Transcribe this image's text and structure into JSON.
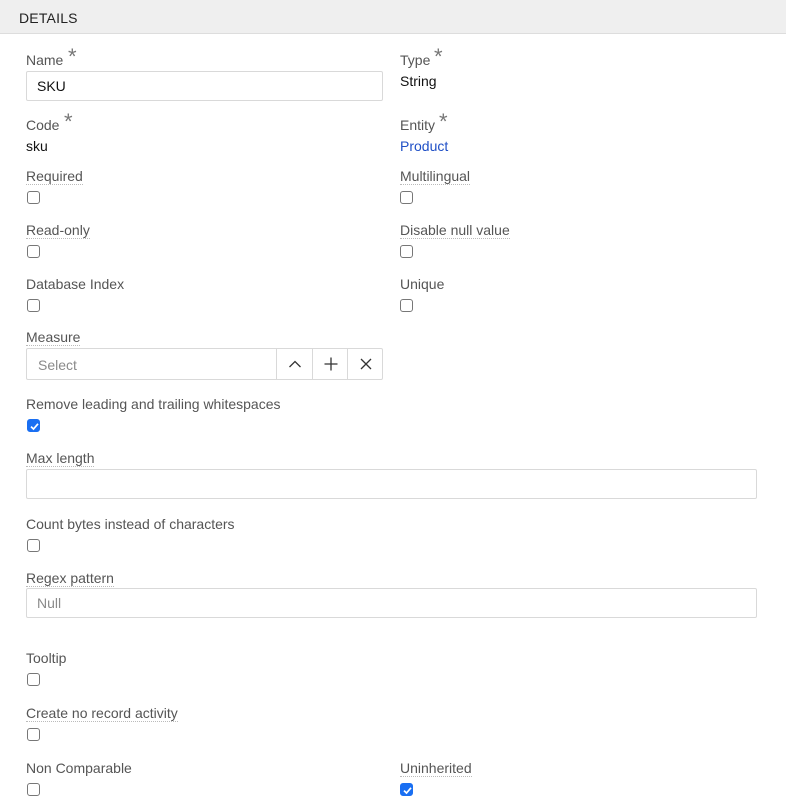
{
  "header": {
    "title": "DETAILS"
  },
  "name": {
    "label": "Name",
    "value": "SKU"
  },
  "type": {
    "label": "Type",
    "value": "String"
  },
  "code": {
    "label": "Code",
    "value": "sku"
  },
  "entity": {
    "label": "Entity",
    "value": "Product"
  },
  "required_mark": "*",
  "checkboxes": {
    "required": {
      "label": "Required",
      "checked": false
    },
    "multilingual": {
      "label": "Multilingual",
      "checked": false
    },
    "read_only": {
      "label": "Read-only",
      "checked": false
    },
    "disable_null_value": {
      "label": "Disable null value",
      "checked": false
    },
    "database_index": {
      "label": "Database Index",
      "checked": false
    },
    "unique": {
      "label": "Unique",
      "checked": false
    },
    "remove_whitespaces": {
      "label": "Remove leading and trailing whitespaces",
      "checked": true
    },
    "count_bytes": {
      "label": "Count bytes instead of characters",
      "checked": false
    },
    "tooltip": {
      "label": "Tooltip",
      "checked": false
    },
    "create_no_record_activity": {
      "label": "Create no record activity",
      "checked": false
    },
    "non_comparable": {
      "label": "Non Comparable",
      "checked": false
    },
    "uninherited": {
      "label": "Uninherited",
      "checked": true
    }
  },
  "measure": {
    "label": "Measure",
    "placeholder": "Select"
  },
  "max_length": {
    "label": "Max length",
    "value": ""
  },
  "regex_pattern": {
    "label": "Regex pattern",
    "placeholder": "Null"
  },
  "colors": {
    "accent": "#1a6ff2",
    "link": "#1f4fc6"
  }
}
